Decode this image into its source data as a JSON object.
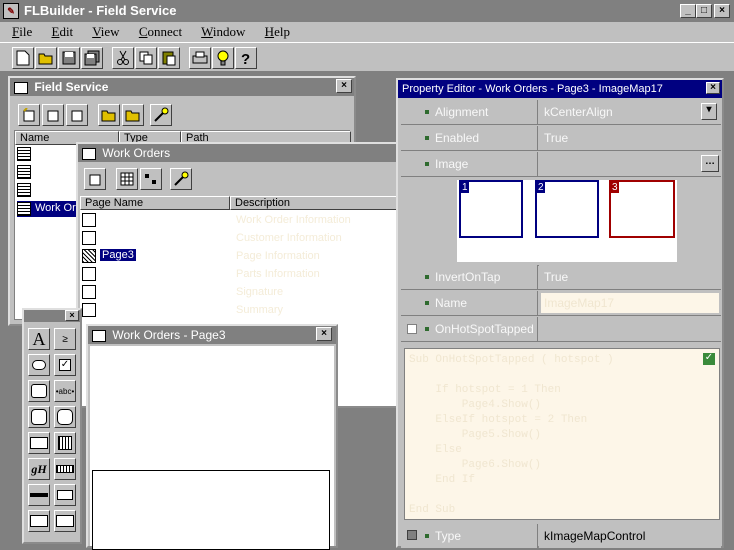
{
  "app": {
    "title": "FLBuilder - Field Service"
  },
  "menu": [
    "File",
    "Edit",
    "View",
    "Connect",
    "Window",
    "Help"
  ],
  "menu_accel": [
    "F",
    "E",
    "V",
    "C",
    "W",
    "H"
  ],
  "field_service": {
    "title": "Field Service",
    "columns": [
      "Name",
      "Type",
      "Path"
    ],
    "rows": [
      {
        "name": "Work Or"
      }
    ]
  },
  "work_orders": {
    "title": "Work Orders",
    "columns": [
      "Page Name",
      "Description"
    ],
    "rows": [
      {
        "name": "",
        "desc": "Work Order Information"
      },
      {
        "name": "",
        "desc": "Customer Information"
      },
      {
        "name": "Page3",
        "desc": "Page Information"
      },
      {
        "name": "",
        "desc": "Parts Information"
      },
      {
        "name": "",
        "desc": "Signature"
      },
      {
        "name": "",
        "desc": "Summary"
      }
    ]
  },
  "page3_window": {
    "title": "Work Orders - Page3"
  },
  "property_editor": {
    "title": "Property Editor - Work Orders - Page3 - ImageMap17",
    "properties": [
      {
        "name": "Alignment",
        "value": "kCenterAlign"
      },
      {
        "name": "Enabled",
        "value": "True"
      },
      {
        "name": "Image",
        "value": ""
      },
      {
        "name": "InvertOnTap",
        "value": "True"
      },
      {
        "name": "Name",
        "value": "ImageMap17"
      },
      {
        "name": "OnHotSpotTapped",
        "value": ""
      },
      {
        "name": "Type",
        "value": "kImageMapControl"
      }
    ],
    "hotspots": [
      "1",
      "2",
      "3"
    ],
    "code": [
      "Sub OnHotSpotTapped ( hotspot )",
      "",
      "    If hotspot = 1 Then",
      "        Page4.Show()",
      "    ElseIf hotspot = 2 Then",
      "        Page5.Show()",
      "    Else",
      "        Page6.Show()",
      "    End If",
      "",
      "End Sub"
    ],
    "colors": {
      "hotspot1": "#000080",
      "hotspot2": "#000080",
      "hotspot3": "#a00000",
      "code_bg": "#fdf6e8"
    }
  }
}
